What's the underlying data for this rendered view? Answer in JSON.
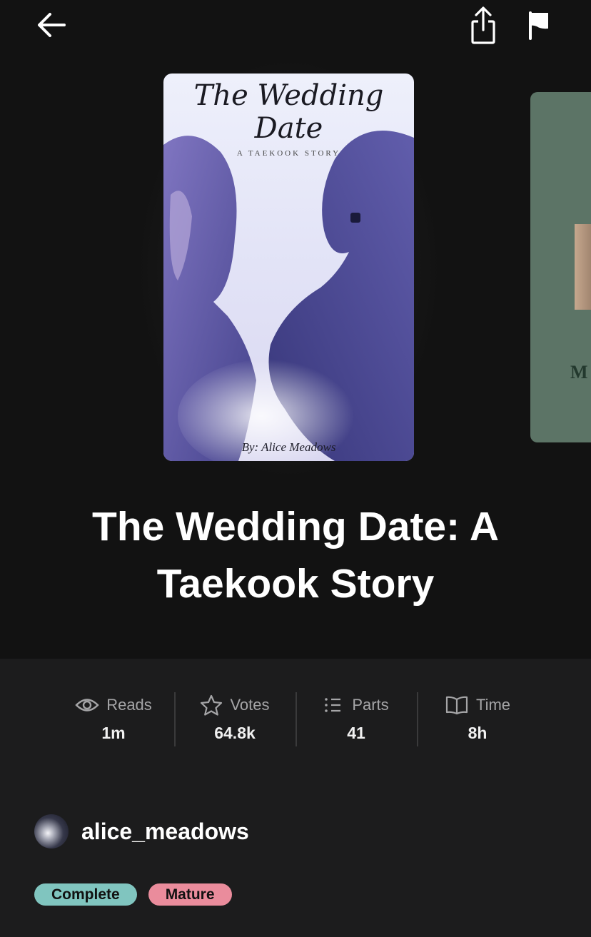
{
  "toolbar": {
    "back_icon": "back-arrow-icon",
    "share_icon": "share-icon",
    "flag_icon": "flag-icon"
  },
  "cover": {
    "title_line1": "The Wedding",
    "title_line2": "Date",
    "subtitle": "A TAEKOOK STORY",
    "author_credit": "By: Alice Meadows"
  },
  "next_cover": {
    "partial_letter": "M"
  },
  "story": {
    "title_line1": "The Wedding Date: A",
    "title_line2": "Taekook Story"
  },
  "stats": [
    {
      "label": "Reads",
      "value": "1m",
      "icon": "eye-icon"
    },
    {
      "label": "Votes",
      "value": "64.8k",
      "icon": "star-icon"
    },
    {
      "label": "Parts",
      "value": "41",
      "icon": "list-icon"
    },
    {
      "label": "Time",
      "value": "8h",
      "icon": "book-icon"
    }
  ],
  "author": {
    "username": "alice_meadows"
  },
  "tags": {
    "complete": "Complete",
    "mature": "Mature"
  },
  "colors": {
    "background": "#121212",
    "panel": "#1c1c1d",
    "complete_tag": "#80c5bf",
    "mature_tag": "#ea8c9c"
  }
}
